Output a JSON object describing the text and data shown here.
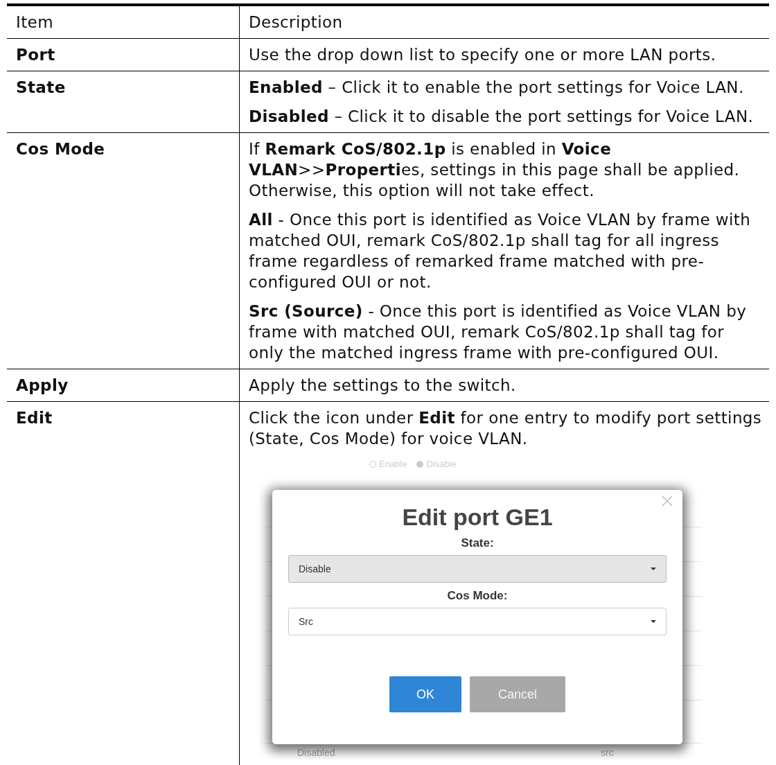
{
  "table": {
    "columns": [
      "Item",
      "Description"
    ],
    "rows": [
      {
        "item": "Port",
        "paragraphs": [
          "Use the drop down list to specify one or more LAN ports."
        ]
      },
      {
        "item": "State",
        "paragraphs": [
          "**Enabled** – Click it to enable the port settings for Voice LAN.",
          "**Disabled** – Click it to disable the port settings for Voice LAN."
        ]
      },
      {
        "item": "Cos Mode",
        "paragraphs": [
          "If **Remark CoS/802.1p** is enabled in **Voice VLAN**>>**Properti**es, settings in this page shall be applied. Otherwise, this option will not take effect.",
          "**All** - Once this port is identified as Voice VLAN by frame with matched OUI, remark CoS/802.1p shall tag for all ingress frame regardless of remarked frame matched with pre-configured OUI or not.",
          "**Src (Source)** - Once this port is identified as Voice VLAN by frame with matched OUI, remark CoS/802.1p shall tag for only the matched ingress frame with pre-configured OUI."
        ]
      },
      {
        "item": "Apply",
        "paragraphs": [
          "Apply the settings to the switch."
        ]
      },
      {
        "item": "Edit",
        "paragraphs": [
          "Click the icon under **Edit** for one entry to modify port settings (State, Cos Mode) for voice VLAN."
        ],
        "screenshot": {
          "background": {
            "radios": [
              {
                "label": "Enable",
                "selected": false
              },
              {
                "label": "Disable",
                "selected": true
              }
            ],
            "row": [
              "Disabled",
              "src"
            ]
          },
          "dialog": {
            "title": "Edit port GE1",
            "fields": [
              {
                "label": "State:",
                "value": "Disable",
                "disabled": true
              },
              {
                "label": "Cos Mode:",
                "value": "Src",
                "disabled": false
              }
            ],
            "buttons": [
              {
                "label": "OK",
                "kind": "primary"
              },
              {
                "label": "Cancel",
                "kind": "secondary"
              }
            ]
          }
        }
      }
    ]
  }
}
